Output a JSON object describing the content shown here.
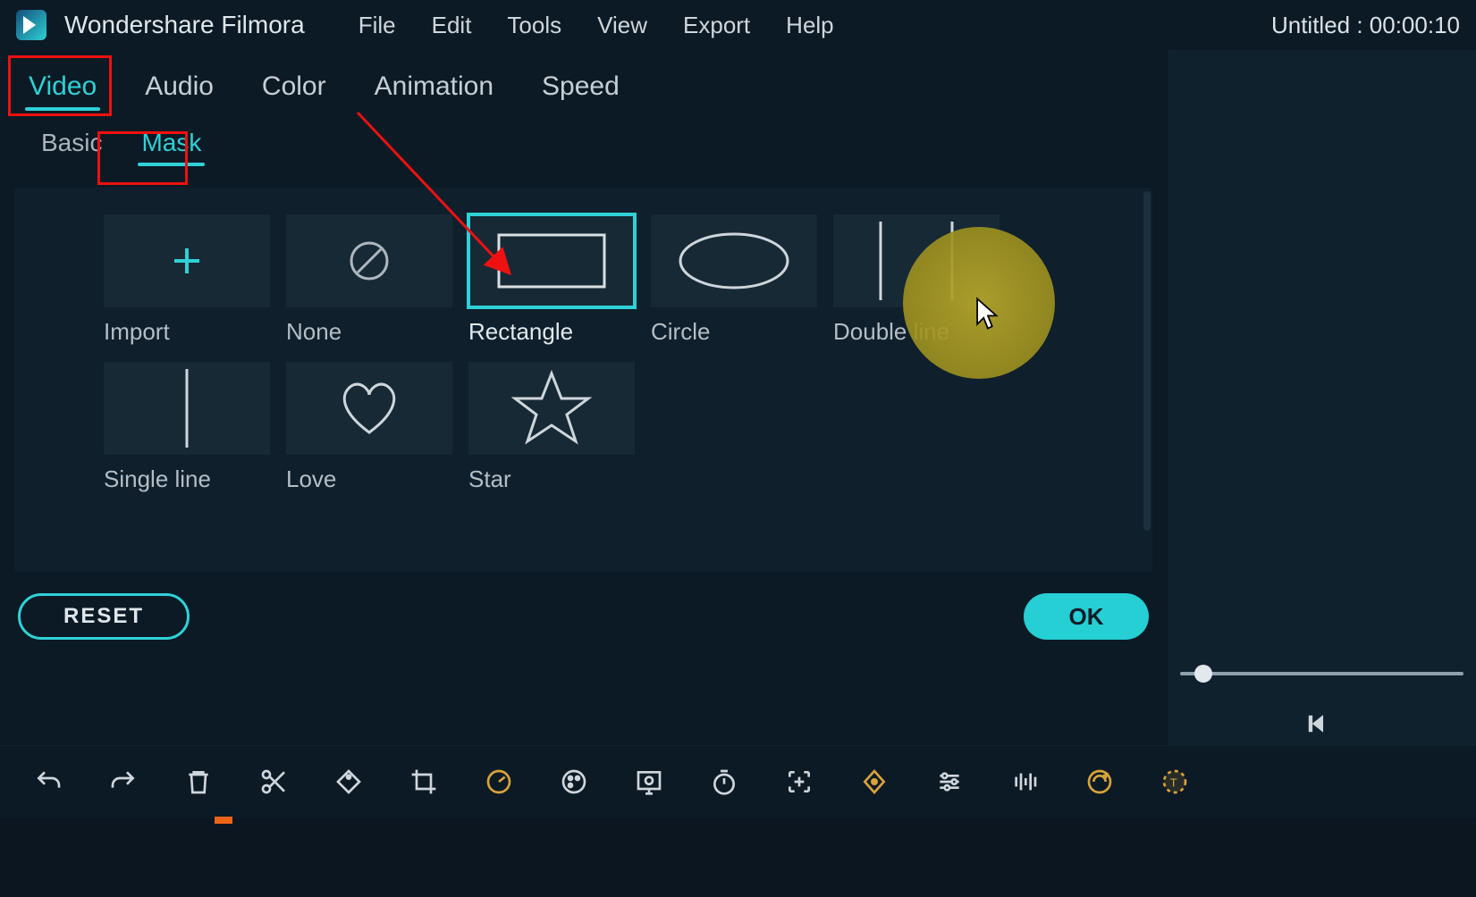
{
  "app": {
    "title": "Wondershare Filmora",
    "doc_title": "Untitled : 00:00:10"
  },
  "menu": {
    "file": "File",
    "edit": "Edit",
    "tools": "Tools",
    "view": "View",
    "export": "Export",
    "help": "Help"
  },
  "prop_tabs": {
    "video": "Video",
    "audio": "Audio",
    "color": "Color",
    "animation": "Animation",
    "speed": "Speed"
  },
  "sub_tabs": {
    "basic": "Basic",
    "mask": "Mask"
  },
  "masks": {
    "import": "Import",
    "none": "None",
    "rectangle": "Rectangle",
    "circle": "Circle",
    "double_line": "Double line",
    "single_line": "Single line",
    "love": "Love",
    "star": "Star"
  },
  "buttons": {
    "reset": "RESET",
    "ok": "OK"
  }
}
